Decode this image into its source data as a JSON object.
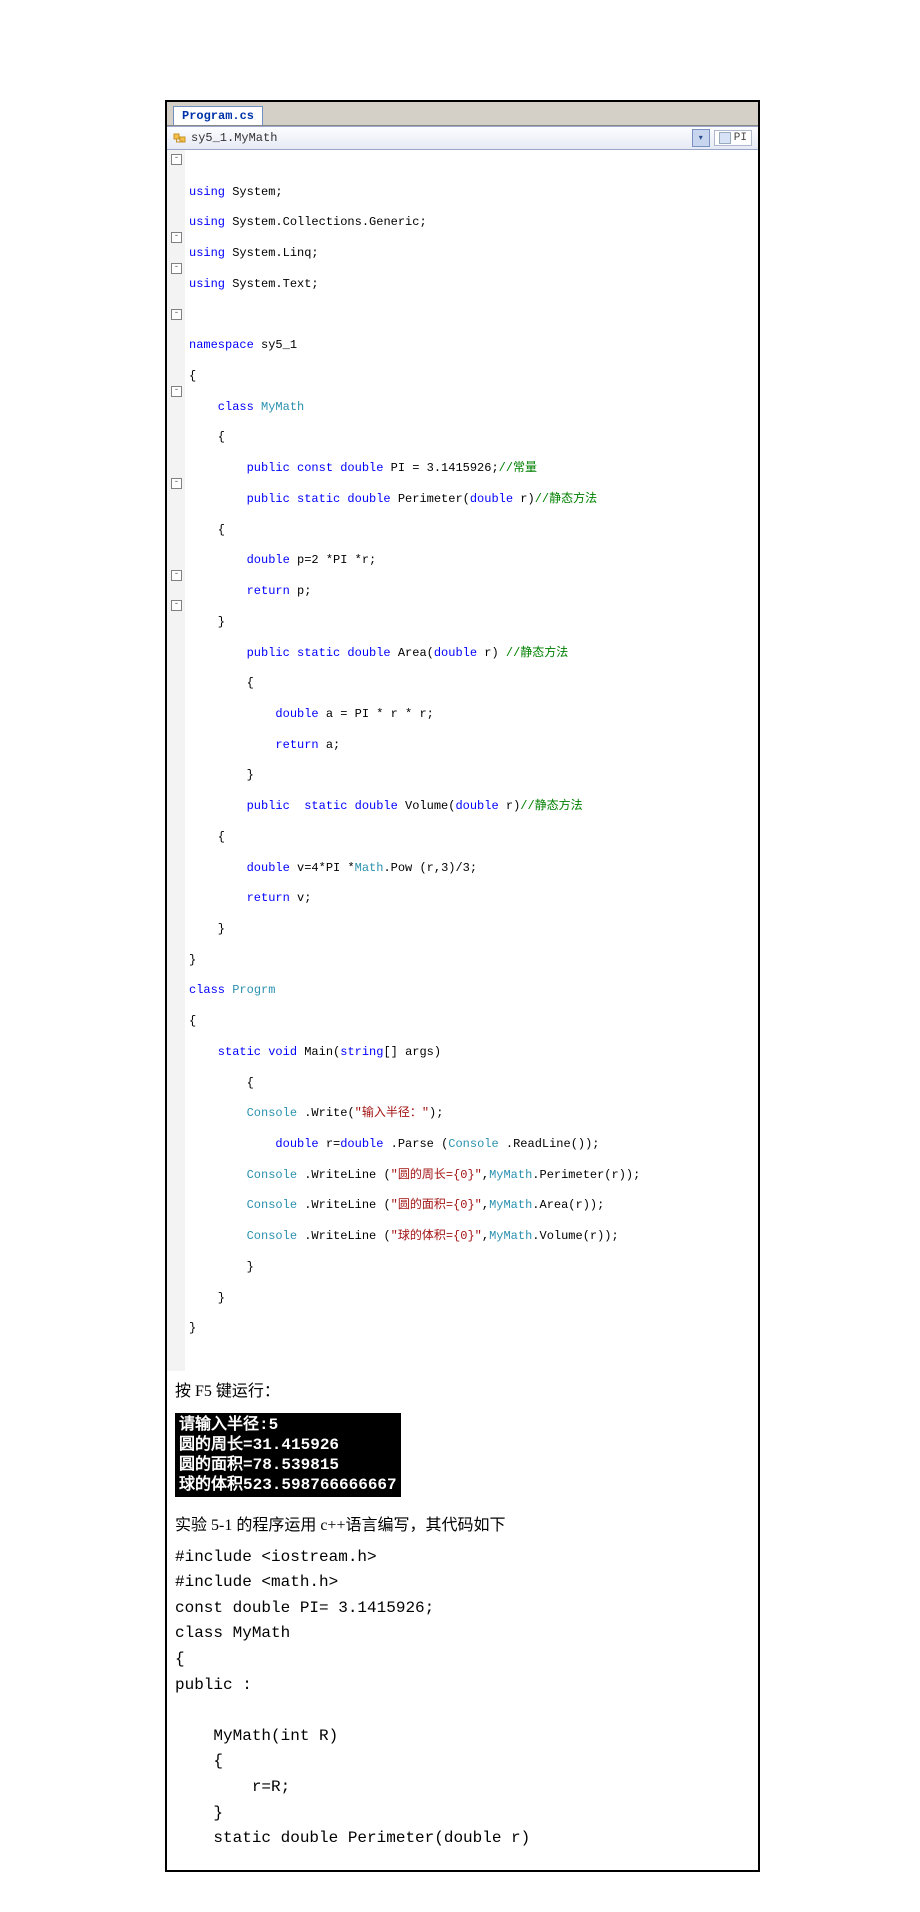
{
  "ide": {
    "tab_title": "Program.cs",
    "nav_combo": "sy5_1.MyMath",
    "nav_right": "PI"
  },
  "csharp": {
    "l1": "using",
    "l1b": " System;",
    "l2": "using",
    "l2b": " System.Collections.Generic;",
    "l3": "using",
    "l3b": " System.Linq;",
    "l4": "using",
    "l4b": " System.Text;",
    "l6a": "namespace",
    "l6b": " sy5_1",
    "l7": "{",
    "l8a": "    class",
    "l8b": " MyMath",
    "l9": "    {",
    "l10a": "        public const double",
    "l10b": " PI = 3.1415926;",
    "l10c": "//常量",
    "l11a": "        public static double",
    "l11b": " Perimeter(",
    "l11c": "double",
    "l11d": " r)",
    "l11e": "//静态方法",
    "l12": "    {",
    "l13a": "        double",
    "l13b": " p=2 *PI *r;",
    "l14a": "        return",
    "l14b": " p;",
    "l15": "    }",
    "l16a": "        public static double",
    "l16b": " Area(",
    "l16c": "double",
    "l16d": " r) ",
    "l16e": "//静态方法",
    "l17": "        {",
    "l18a": "            double",
    "l18b": " a = PI * r * r;",
    "l19a": "            return",
    "l19b": " a;",
    "l20": "        }",
    "l21a": "        public  static double",
    "l21b": " Volume(",
    "l21c": "double",
    "l21d": " r)",
    "l21e": "//静态方法",
    "l22": "    {",
    "l23a": "        double",
    "l23b": " v=4*PI *",
    "l23c": "Math",
    "l23d": ".Pow (r,3)/3;",
    "l24a": "        return",
    "l24b": " v;",
    "l25": "    }",
    "l26": "}",
    "l27a": "class",
    "l27b": " Progrm",
    "l28": "{",
    "l29a": "    static void",
    "l29b": " Main(",
    "l29c": "string",
    "l29d": "[] args)",
    "l30": "        {",
    "l31a": "        Console",
    "l31b": " .Write(",
    "l31c": "\"输入半径：\"",
    "l31d": ");",
    "l32a": "            double",
    "l32b": " r=",
    "l32c": "double",
    "l32d": " .Parse (",
    "l32e": "Console",
    "l32f": " .ReadLine());",
    "l33a": "        Console",
    "l33b": " .WriteLine (",
    "l33c": "\"圆的周长={0}\"",
    "l33d": ",",
    "l33e": "MyMath",
    "l33f": ".Perimeter(r));",
    "l34a": "        Console",
    "l34b": " .WriteLine (",
    "l34c": "\"圆的面积={0}\"",
    "l34d": ",",
    "l34e": "MyMath",
    "l34f": ".Area(r));",
    "l35a": "        Console",
    "l35b": " .WriteLine (",
    "l35c": "\"球的体积={0}\"",
    "l35d": ",",
    "l35e": "MyMath",
    "l35f": ".Volume(r));",
    "l36": "        }",
    "l37": "    }",
    "l38": "}"
  },
  "doc": {
    "run_label": "按 F5 键运行：",
    "console1": "请输入半径:5",
    "console2": "圆的周长=31.415926",
    "console3": "圆的面积=78.539815",
    "console4": "球的体积523.598766666667",
    "cpp_intro": "实验 5-1 的程序运用 c++语言编写，其代码如下",
    "cpp": "#include <iostream.h>\n#include <math.h>\nconst double PI= 3.1415926;\nclass MyMath\n{\npublic :\n\n    MyMath(int R)\n    {\n        r=R;\n    }\n    static double Perimeter(double r)"
  }
}
